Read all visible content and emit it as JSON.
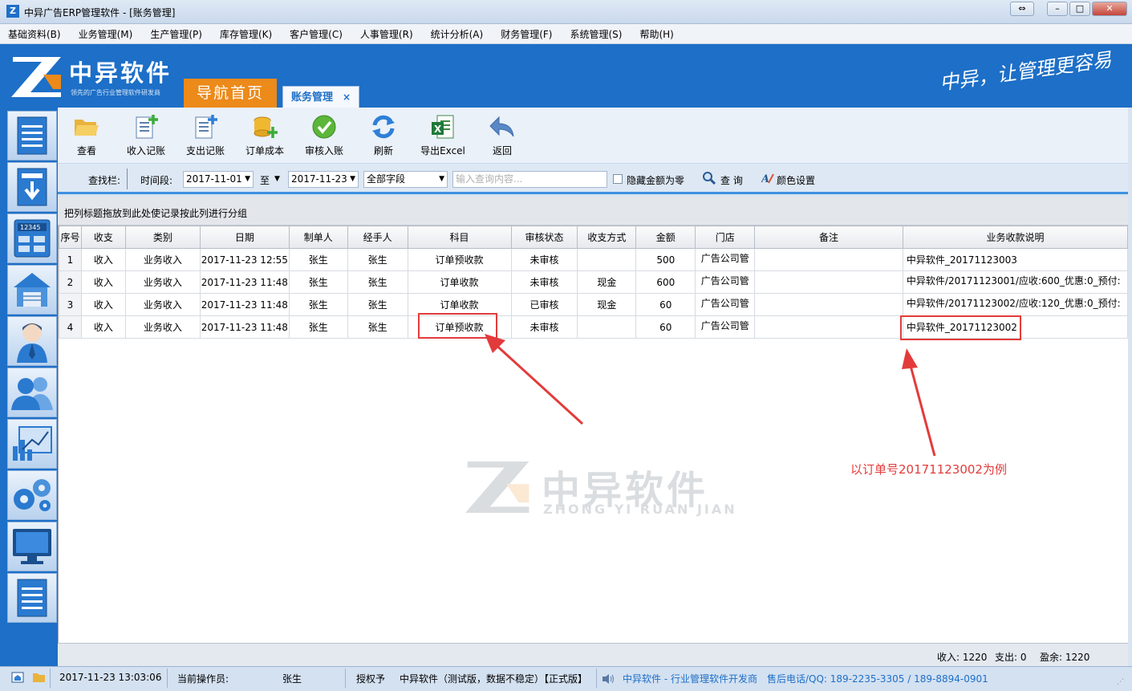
{
  "window": {
    "title": "中异广告ERP管理软件 - [账务管理]",
    "app_icon": "Z"
  },
  "menu": [
    "基础资料(B)",
    "业务管理(M)",
    "生产管理(P)",
    "库存管理(K)",
    "客户管理(C)",
    "人事管理(R)",
    "统计分析(A)",
    "财务管理(F)",
    "系统管理(S)",
    "帮助(H)"
  ],
  "brand": {
    "name": "中异软件",
    "tagline": "领先的广告行业管理软件研发商",
    "slogan": "中异，让管理更容易"
  },
  "tabs": {
    "home": "导航首页",
    "active": "账务管理",
    "close": "×"
  },
  "toolbar": {
    "view": "查看",
    "income": "收入记账",
    "expense": "支出记账",
    "order_cost": "订单成本",
    "approve": "审核入账",
    "refresh": "刷新",
    "export": "导出Excel",
    "back": "返回"
  },
  "search": {
    "label": "查找栏:",
    "period_label": "时间段:",
    "date_from": "2017-11-01",
    "to_label": "至",
    "date_to": "2017-11-23",
    "field": "全部字段",
    "placeholder": "输入查询内容...",
    "hide_zero": "隐藏金额为零",
    "query": "查 询",
    "color": "颜色设置"
  },
  "group_hint": "把列标题拖放到此处使记录按此列进行分组",
  "columns": [
    "序号",
    "收支",
    "类别",
    "日期",
    "制单人",
    "经手人",
    "科目",
    "审核状态",
    "收支方式",
    "金额",
    "门店",
    "备注",
    "业务收款说明"
  ],
  "rows": [
    [
      "1",
      "收入",
      "业务收入",
      "2017-11-23 12:55",
      "张生",
      "张生",
      "订单预收款",
      "未审核",
      "",
      "500",
      "广告公司管",
      "",
      "中异软件_20171123003"
    ],
    [
      "2",
      "收入",
      "业务收入",
      "2017-11-23 11:48",
      "张生",
      "张生",
      "订单收款",
      "未审核",
      "现金",
      "600",
      "广告公司管",
      "",
      "中异软件/20171123001/应收:600_优惠:0_预付:"
    ],
    [
      "3",
      "收入",
      "业务收入",
      "2017-11-23 11:48",
      "张生",
      "张生",
      "订单收款",
      "已审核",
      "现金",
      "60",
      "广告公司管",
      "",
      "中异软件/20171123002/应收:120_优惠:0_预付:"
    ],
    [
      "4",
      "收入",
      "业务收入",
      "2017-11-23 11:48",
      "张生",
      "张生",
      "订单预收款",
      "未审核",
      "",
      "60",
      "广告公司管",
      "",
      "中异软件_20171123002"
    ]
  ],
  "annotation": "以订单号20171123002为例",
  "watermark": {
    "name": "中异软件",
    "pinyin": "ZHONG YI RUAN JIAN"
  },
  "summary": {
    "income": "收入: 1220",
    "expense": "支出: 0",
    "balance": "盈余: 1220"
  },
  "status": {
    "datetime": "2017-11-23 13:03:06",
    "operator_label": "当前操作员:",
    "operator": "张生",
    "license_label": "授权予",
    "edition": "中异软件（测试版，数据不稳定）【正式版】",
    "company": "中异软件 - 行业管理软件开发商",
    "contact": "售后电话/QQ: 189-2235-3305 / 189-8894-0901"
  },
  "colors": {
    "brand_blue": "#1d6fc7",
    "nav_orange": "#ec8a1a",
    "highlight_red": "#e33b3b"
  }
}
